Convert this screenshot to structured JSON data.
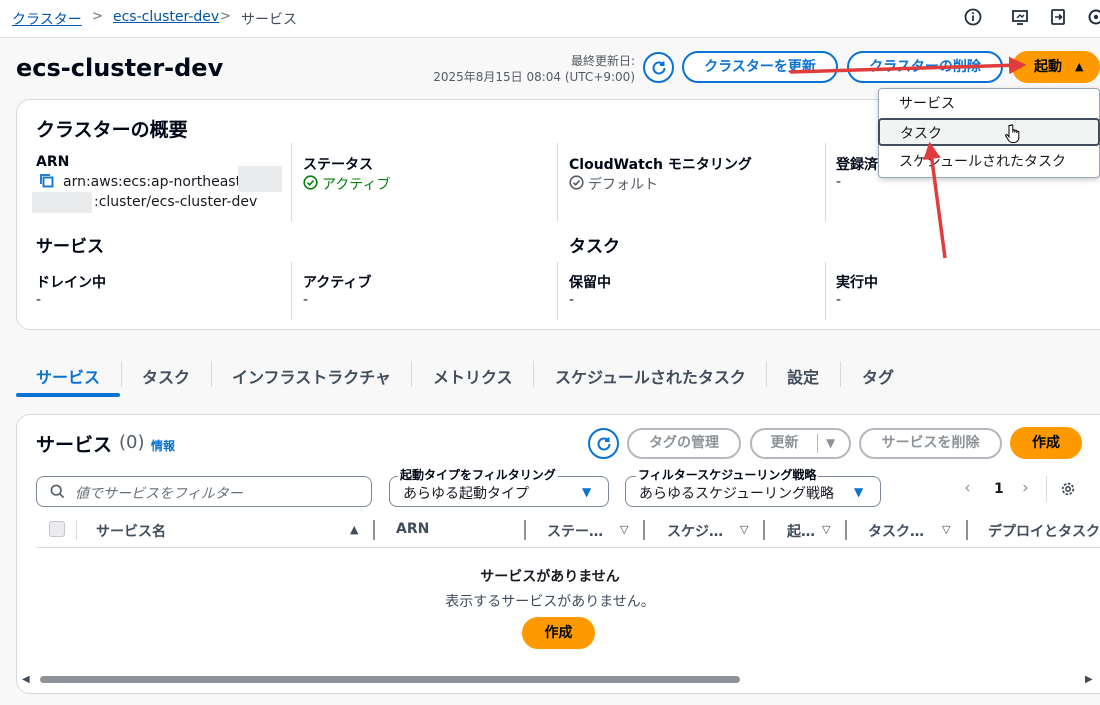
{
  "breadcrumb": {
    "root": "クラスター",
    "cluster": "ecs-cluster-dev",
    "current": "サービス"
  },
  "header": {
    "title": "ecs-cluster-dev",
    "updated_label": "最終更新日:",
    "updated_time": "2025年8月15日 08:04 (UTC+9:00)",
    "update_button": "クラスターを更新",
    "delete_button": "クラスターの削除",
    "launch_button": "起動"
  },
  "launch_menu": {
    "items": [
      "サービス",
      "タスク",
      "スケジュールされたタスク"
    ]
  },
  "overview": {
    "title": "クラスターの概要",
    "arn_label": "ARN",
    "arn_line1": "arn:aws:ecs:ap-northeast-1:",
    "arn_line2": ":cluster/ecs-cluster-dev",
    "status_label": "ステータス",
    "status_value": "アクティブ",
    "cw_label": "CloudWatch モニタリング",
    "cw_value": "デフォルト",
    "registered_label": "登録済",
    "registered_value": "-",
    "services_heading": "サービス",
    "tasks_heading": "タスク",
    "draining_label": "ドレイン中",
    "draining_value": "-",
    "active_label": "アクティブ",
    "active_value": "-",
    "pending_label": "保留中",
    "pending_value": "-",
    "running_label": "実行中",
    "running_value": "-"
  },
  "tabs": [
    "サービス",
    "タスク",
    "インフラストラクチャ",
    "メトリクス",
    "スケジュールされたタスク",
    "設定",
    "タグ"
  ],
  "services_panel": {
    "title": "サービス",
    "count": "(0)",
    "info": "情報",
    "manage_tags": "タグの管理",
    "update": "更新",
    "delete": "サービスを削除",
    "create": "作成",
    "filter_placeholder": "値でサービスをフィルター",
    "launch_type_label": "起動タイプをフィルタリング",
    "launch_type_value": "あらゆる起動タイプ",
    "strategy_label": "フィルタースケジューリング戦略",
    "strategy_value": "あらゆるスケジューリング戦略",
    "page": "1",
    "columns": [
      "サービス名",
      "ARN",
      "ステー…",
      "スケジ…",
      "起…",
      "タスク…",
      "デプロイとタスク"
    ],
    "empty_title": "サービスがありません",
    "empty_desc": "表示するサービスがありません。",
    "empty_create": "作成"
  },
  "colors": {
    "link": "#0055aa",
    "primary": "#ff9900",
    "accent": "#0972d3",
    "annotation": "#e03c3c",
    "success": "#037f0c"
  },
  "icons": [
    "info-icon",
    "screen-icon",
    "export-icon",
    "settings-icon",
    "refresh-icon",
    "copy-icon",
    "check-circle-icon",
    "search-icon",
    "chevron-left-icon",
    "chevron-right-icon",
    "gear-icon",
    "caret-down-icon",
    "sort-up-icon",
    "cursor-hand-icon"
  ]
}
